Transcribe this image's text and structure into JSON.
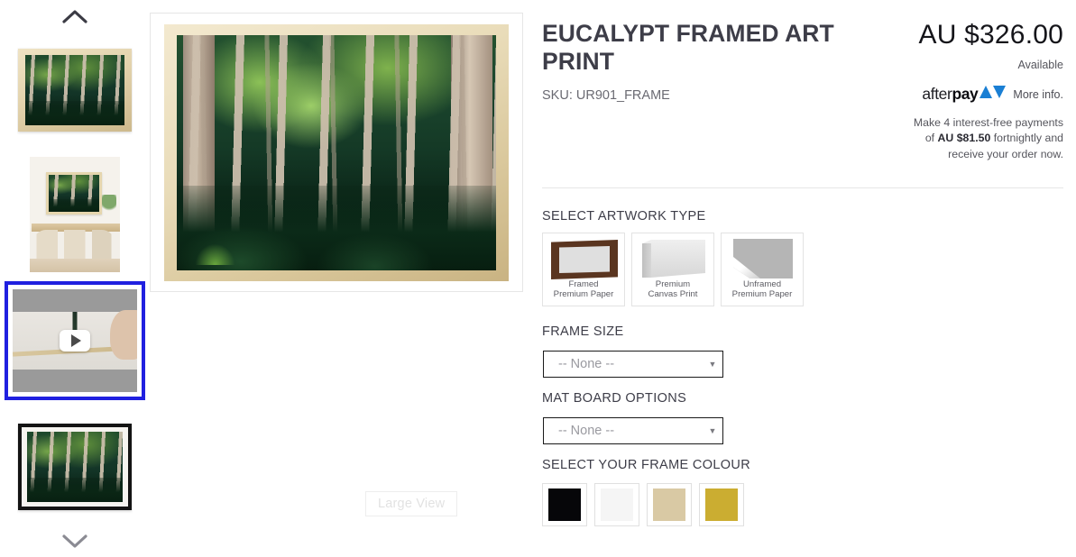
{
  "product": {
    "title": "EUCALYPT FRAMED ART PRINT",
    "sku": "SKU: UR901_FRAME",
    "price": "AU $326.00",
    "availability": "Available"
  },
  "afterpay": {
    "logo_after": "after",
    "logo_pay": "pay",
    "more_info": "More info.",
    "terms_line1": "Make 4 interest-free payments",
    "terms_line2_prefix": "of ",
    "terms_amount": "AU $81.50",
    "terms_line2_suffix": " fortnightly and",
    "terms_line3": "receive your order now."
  },
  "gallery": {
    "scroll_up_label": "Previous images",
    "scroll_down_label": "Next images",
    "large_view_label": "Large View",
    "thumbnails": [
      {
        "name": "framed-art-print",
        "type": "image",
        "selected": false
      },
      {
        "name": "room-scene",
        "type": "image",
        "selected": false
      },
      {
        "name": "product-video",
        "type": "video",
        "selected": true
      },
      {
        "name": "black-framed-art-print",
        "type": "image",
        "selected": false
      }
    ]
  },
  "options": {
    "artwork_type_label": "SELECT ARTWORK TYPE",
    "artwork_types": [
      {
        "line1": "Framed",
        "line2": "Premium Paper",
        "icon": "framed-print-icon"
      },
      {
        "line1": "Premium",
        "line2": "Canvas Print",
        "icon": "canvas-print-icon"
      },
      {
        "line1": "Unframed",
        "line2": "Premium Paper",
        "icon": "unframed-paper-icon"
      }
    ],
    "frame_size_label": "FRAME SIZE",
    "frame_size_value": "-- None --",
    "mat_board_label": "MAT BOARD OPTIONS",
    "mat_board_value": "-- None --",
    "frame_colour_label": "SELECT YOUR FRAME COLOUR",
    "frame_colours": [
      {
        "name": "black",
        "hex": "#060609"
      },
      {
        "name": "white",
        "hex": "#f5f5f5"
      },
      {
        "name": "natural-beige",
        "hex": "#d9c9a4"
      },
      {
        "name": "gold",
        "hex": "#cbad31"
      }
    ]
  },
  "theme": {
    "selection_border": "#2020e0",
    "text_dark": "#3d3d48",
    "text_muted": "#6a6a72",
    "afterpay_accent": "#1a7fd4"
  }
}
